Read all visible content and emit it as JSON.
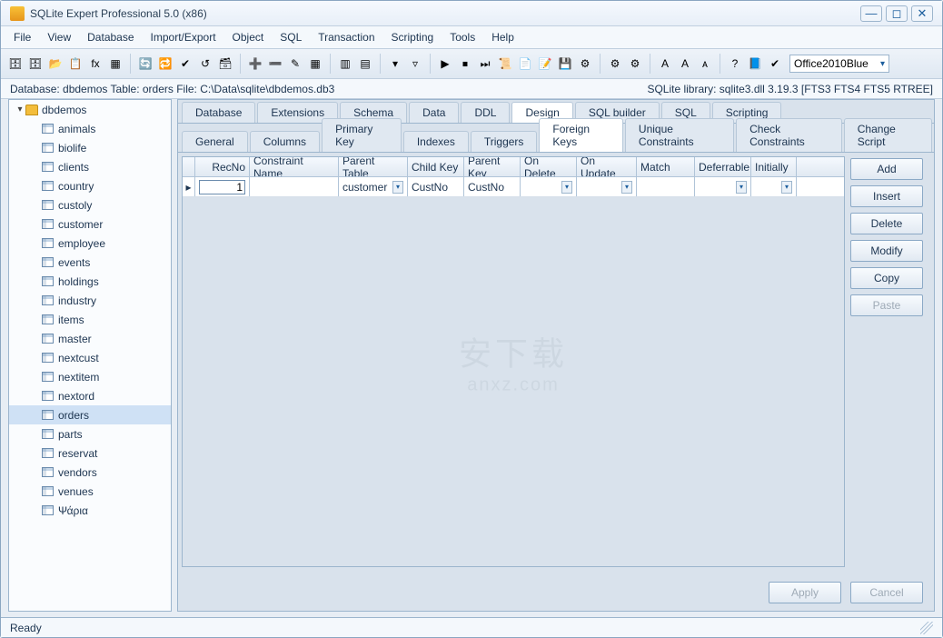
{
  "window": {
    "title": "SQLite Expert Professional 5.0 (x86)"
  },
  "menu": [
    "File",
    "View",
    "Database",
    "Import/Export",
    "Object",
    "SQL",
    "Transaction",
    "Scripting",
    "Tools",
    "Help"
  ],
  "toolbar": {
    "icons": [
      "db-add",
      "db-remove",
      "db-open",
      "db-copy",
      "fx",
      "sql",
      "divider",
      "refresh",
      "refresh-all",
      "commit",
      "rollback",
      "db-action",
      "divider",
      "grid-insert",
      "grid-delete",
      "grid-edit",
      "grid-grid",
      "divider",
      "col-add",
      "col-remove",
      "divider",
      "filter",
      "filter-clear",
      "divider",
      "play",
      "stop",
      "step",
      "script",
      "script-open",
      "script-new",
      "script-save",
      "script-run",
      "divider",
      "settings",
      "gear",
      "divider",
      "font",
      "font-inc",
      "font-dec",
      "divider",
      "help",
      "doc",
      "check"
    ],
    "theme": "Office2010Blue"
  },
  "infobar": {
    "left": "Database: dbdemos    Table: orders    File: C:\\Data\\sqlite\\dbdemos.db3",
    "right": "SQLite library: sqlite3.dll 3.19.3 [FTS3 FTS4 FTS5 RTREE]"
  },
  "sidebar": {
    "db": "dbdemos",
    "tables": [
      "animals",
      "biolife",
      "clients",
      "country",
      "custoly",
      "customer",
      "employee",
      "events",
      "holdings",
      "industry",
      "items",
      "master",
      "nextcust",
      "nextitem",
      "nextord",
      "orders",
      "parts",
      "reservat",
      "vendors",
      "venues",
      "Ψάρια"
    ],
    "selected": "orders"
  },
  "tabs": {
    "main": [
      "Database",
      "Extensions",
      "Schema",
      "Data",
      "DDL",
      "Design",
      "SQL builder",
      "SQL",
      "Scripting"
    ],
    "main_active": "Design",
    "sub": [
      "General",
      "Columns",
      "Primary Key",
      "Indexes",
      "Triggers",
      "Foreign Keys",
      "Unique Constraints",
      "Check Constraints",
      "Change Script"
    ],
    "sub_active": "Foreign Keys"
  },
  "grid": {
    "headers": [
      "RecNo",
      "Constraint Name",
      "Parent Table",
      "Child Key",
      "Parent Key",
      "On Delete",
      "On Update",
      "Match",
      "Deferrable",
      "Initially"
    ],
    "row": {
      "recno": "1",
      "constraint_name": "",
      "parent_table": "customer",
      "child_key": "CustNo",
      "parent_key": "CustNo",
      "on_delete": "",
      "on_update": "",
      "match": "",
      "deferrable": "",
      "initially": ""
    }
  },
  "buttons": {
    "actions": [
      "Add",
      "Insert",
      "Delete",
      "Modify",
      "Copy",
      "Paste"
    ],
    "disabled": [
      "Paste"
    ],
    "bottom": [
      "Apply",
      "Cancel"
    ]
  },
  "status": "Ready",
  "watermark": {
    "line1": "安下载",
    "line2": "anxz.com"
  }
}
